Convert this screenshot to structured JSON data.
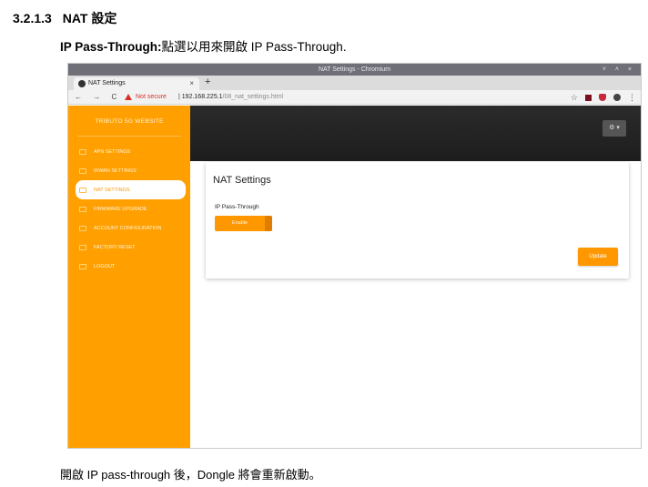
{
  "doc": {
    "section_number": "3.2.1.3",
    "section_title": "NAT 設定",
    "intro_bold": "IP Pass-Through:",
    "intro_text": "點選以用來開啟 IP Pass-Through.",
    "footer": "開啟 IP pass-through 後，Dongle 將會重新啟動。"
  },
  "browser": {
    "window_title": "NAT Settings - Chromium",
    "tab_title": "NAT Settings",
    "tab_close": "×",
    "new_tab": "+",
    "nav_buttons": "← → C",
    "not_secure": "Not secure",
    "url_separator": "|",
    "url_host": "192.168.225.1",
    "url_path": "/08_nat_settings.html",
    "window_controls": "˅ ˄ ×",
    "menu": "⋮",
    "star": "☆"
  },
  "app": {
    "site_title": "TRIBUTO 5G WEBSITE",
    "gear_label": "⚙ ▾",
    "sidebar": [
      {
        "label": "APN SETTINGS"
      },
      {
        "label": "WWAN SETTINGS"
      },
      {
        "label": "NAT SETTINGS",
        "active": true
      },
      {
        "label": "FIRMWARE UPGRADE"
      },
      {
        "label": "ACCOUNT CONFIGURATION"
      },
      {
        "label": "FACTORY RESET"
      },
      {
        "label": "LOGOUT"
      }
    ],
    "card_title": "NAT Settings",
    "field_label": "IP Pass-Through",
    "toggle_label": "Enable",
    "update_label": "Update"
  },
  "colors": {
    "accent": "#ff9800",
    "sidebar": "#ffa000",
    "header": "#222222",
    "warning": "#d93025"
  }
}
